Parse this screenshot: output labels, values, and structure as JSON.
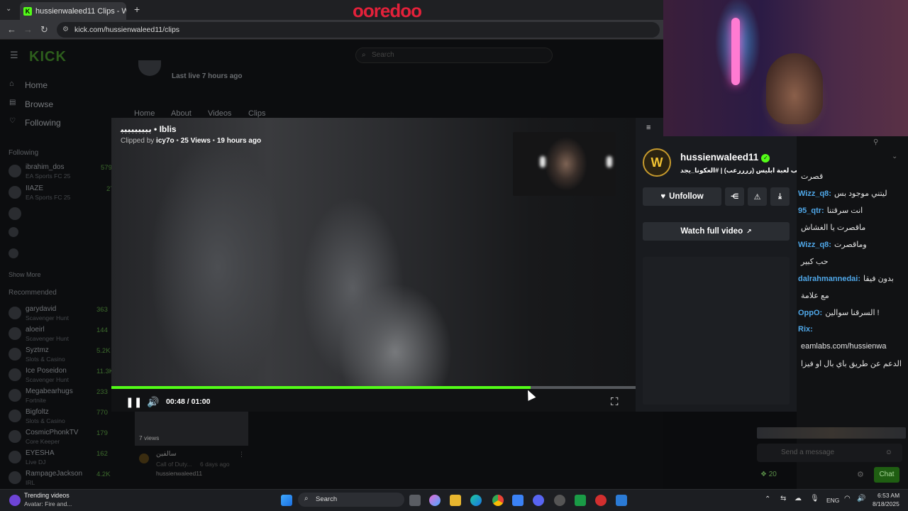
{
  "browser": {
    "tab_title": "hussienwaleed11 Clips - W",
    "url": "kick.com/hussienwaleed11/clips",
    "overlay_brand": "ooredoo"
  },
  "page": {
    "logo": "KICK",
    "search_placeholder": "Search",
    "last_live": "Last live 7 hours ago",
    "channel_tabs": [
      "Home",
      "About",
      "Videos",
      "Clips"
    ],
    "nav": [
      "Home",
      "Browse",
      "Following"
    ],
    "following_header": "Following",
    "following": [
      {
        "name": "ibrahim_dos",
        "game": "EA Sports FC 25",
        "count": "579"
      },
      {
        "name": "IIAZE",
        "game": "EA Sports FC 25",
        "count": "27"
      },
      {
        "name": "",
        "game": "",
        "count": ""
      },
      {
        "name": "",
        "game": "",
        "count": ""
      },
      {
        "name": "",
        "game": "",
        "count": ""
      }
    ],
    "show_more": "Show More",
    "recommended_header": "Recommended",
    "recommended": [
      {
        "name": "garydavid",
        "game": "Scavenger Hunt",
        "count": "363"
      },
      {
        "name": "aloeirl",
        "game": "Scavenger Hunt",
        "count": "144"
      },
      {
        "name": "Syztmz",
        "game": "Slots & Casino",
        "count": "5.2K"
      },
      {
        "name": "Ice Poseidon",
        "game": "Scavenger Hunt",
        "count": "11.3K"
      },
      {
        "name": "Megabearhugs",
        "game": "Fortnite",
        "count": "233"
      },
      {
        "name": "Bigfoltz",
        "game": "Slots & Casino",
        "count": "770"
      },
      {
        "name": "CosmicPhonkTV",
        "game": "Core Keeper",
        "count": "179"
      },
      {
        "name": "EYESHA",
        "game": "Live DJ",
        "count": "162"
      },
      {
        "name": "RampageJackson",
        "game": "IRL",
        "count": "4.2K"
      }
    ],
    "clip_card": {
      "views": "7 views",
      "title": "سالفين",
      "game": "Call of Duty...",
      "time": "6 days ago",
      "channel": "hussienwaleed11"
    }
  },
  "clip": {
    "title": "ﺑﺒﺒﺒﺒﺒﺒﺒﺒ • Iblis",
    "clipped_by_label": "Clipped by",
    "clipper": "icy7o",
    "views": "25 Views",
    "age": "19 hours ago",
    "time_current": "00:48",
    "time_total": "01:00",
    "time_display": "00:48 / 01:00",
    "progress_fraction": 0.8
  },
  "panel": {
    "channel_name": "hussienwaleed11",
    "stream_title": "نلعب لعبة ابليس (ررررعب) | #العكونا_يجد",
    "unfollow_label": "Unfollow",
    "watch_full_label": "Watch full video"
  },
  "chat": {
    "lines": [
      {
        "user": "",
        "msg": "قصرت"
      },
      {
        "user": "Wizz_q8:",
        "msg": "ليتني موجود بس"
      },
      {
        "user": "95_qtr:",
        "msg": "انت سرقتنا"
      },
      {
        "user": "",
        "msg": "ماقصرت يا الغشاش"
      },
      {
        "user": "Wizz_q8:",
        "msg": "وماقصرت"
      },
      {
        "user": "",
        "msg": "حب كبير"
      },
      {
        "user": "dalrahmannedai:",
        "msg": "بدون فيقا"
      },
      {
        "user": "",
        "msg": "مع علامة"
      },
      {
        "user": "OppO:",
        "msg": "السرقنا سوالين !"
      },
      {
        "user": "Rix:",
        "msg": ""
      },
      {
        "user": "",
        "msg": "eamlabs.com/hussienwa"
      },
      {
        "user": "",
        "msg": "الدعم عن طريق باي بال او فيزا"
      }
    ],
    "placeholder": "Send a message",
    "count": "20",
    "send_label": "Chat"
  },
  "taskbar": {
    "widget_title": "Trending videos",
    "widget_sub": "Avatar: Fire and...",
    "search": "Search",
    "lang": "ENG",
    "time": "6:53 AM",
    "date": "8/18/2025"
  },
  "colors": {
    "accent": "#53fc18",
    "brand": "#e3213a"
  }
}
